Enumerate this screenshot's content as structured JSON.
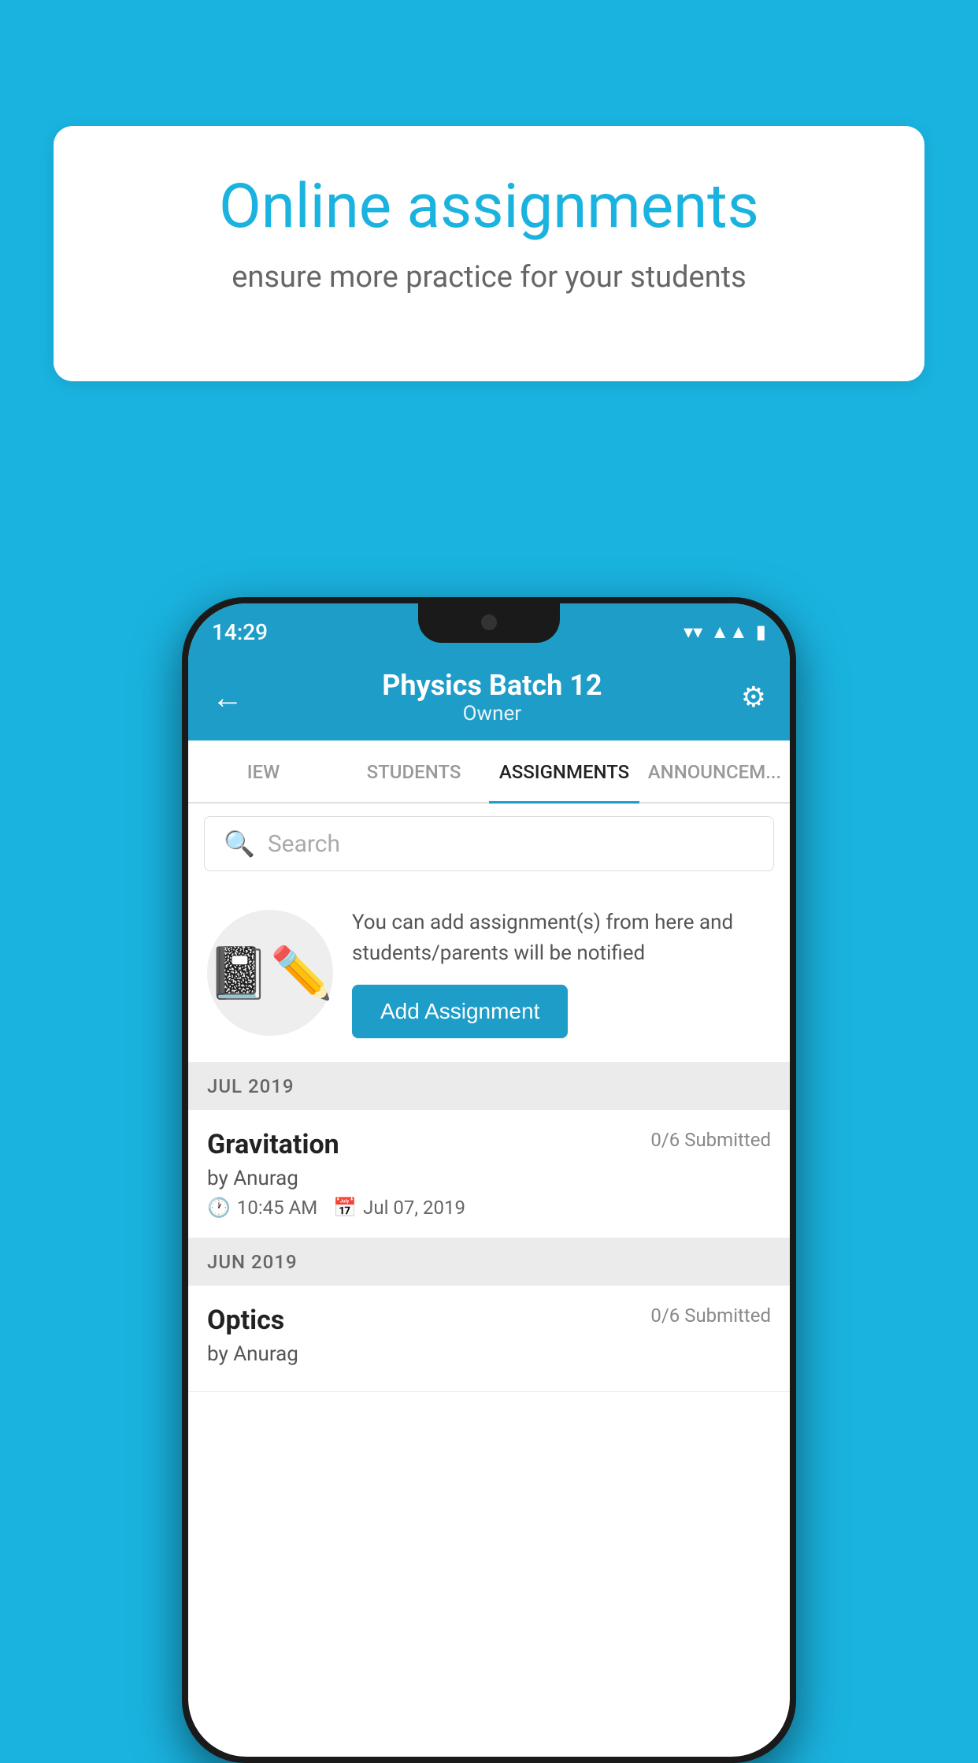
{
  "background_color": "#1ab3e0",
  "speech_bubble": {
    "title": "Online assignments",
    "subtitle": "ensure more practice for your students"
  },
  "status_bar": {
    "time": "14:29",
    "wifi": "▾",
    "signal": "▲",
    "battery": "▮"
  },
  "app_header": {
    "title": "Physics Batch 12",
    "subtitle": "Owner",
    "back_icon": "←",
    "settings_icon": "⚙"
  },
  "tabs": [
    {
      "label": "IEW",
      "active": false
    },
    {
      "label": "STUDENTS",
      "active": false
    },
    {
      "label": "ASSIGNMENTS",
      "active": true
    },
    {
      "label": "ANNOUNCEM...",
      "active": false
    }
  ],
  "search": {
    "placeholder": "Search"
  },
  "promo": {
    "description": "You can add assignment(s) from here and students/parents will be notified",
    "button_label": "Add Assignment"
  },
  "sections": [
    {
      "month_label": "JUL 2019",
      "assignments": [
        {
          "title": "Gravitation",
          "submitted": "0/6 Submitted",
          "author": "by Anurag",
          "time": "10:45 AM",
          "date": "Jul 07, 2019"
        }
      ]
    },
    {
      "month_label": "JUN 2019",
      "assignments": [
        {
          "title": "Optics",
          "submitted": "0/6 Submitted",
          "author": "by Anurag",
          "time": "",
          "date": ""
        }
      ]
    }
  ]
}
